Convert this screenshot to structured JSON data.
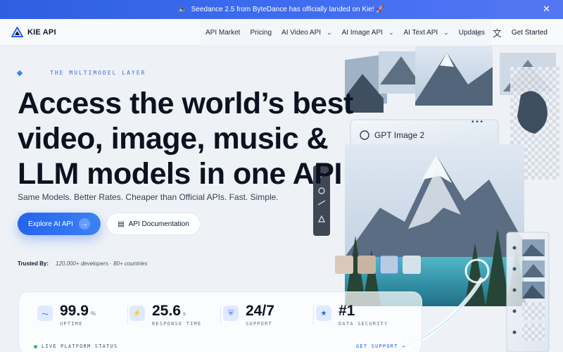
{
  "banner": {
    "text": "Seedance 2.5 from ByteDance has officially landed on Kie! 🚀",
    "speaker": "🔈",
    "close": "✕"
  },
  "nav": {
    "logo": "KIE API",
    "items": [
      {
        "label": "API Market",
        "chevron": false
      },
      {
        "label": "Pricing",
        "chevron": false
      },
      {
        "label": "AI Video API",
        "chevron": true
      },
      {
        "label": "AI Image API",
        "chevron": true
      },
      {
        "label": "AI Text API",
        "chevron": true
      },
      {
        "label": "Updates",
        "chevron": false
      }
    ],
    "theme_icon": "sun-icon",
    "language_icon": "translate-icon",
    "get_started": "Get Started"
  },
  "hero": {
    "eyebrow": "THE MULTIMODEL LAYER",
    "headline_lines": [
      "Access the world’s best",
      "video, image, music &",
      "LLM models in one API"
    ],
    "subhead": "Same Models. Better Rates. Cheaper than Official APIs. Fast. Simple.",
    "primary_button": "Explore AI API",
    "secondary_button": "API Documentation",
    "trusted_label": "Trusted By:",
    "trusted_value": "120,000+ developers · 80+ countries"
  },
  "art": {
    "card_label": "GPT Image 2",
    "menu_dots": "• • •"
  },
  "stats": [
    {
      "value": "99.9",
      "unit": "%",
      "label": "UPTIME",
      "icon": "pulse-icon"
    },
    {
      "value": "25.6",
      "unit": "s",
      "label": "RESPONSE TIME",
      "icon": "bolt-icon"
    },
    {
      "value": "24/7",
      "unit": "",
      "label": "SUPPORT",
      "icon": "shield-icon"
    },
    {
      "value": "#1",
      "unit": "",
      "label": "DATA SECURITY",
      "icon": "star-icon"
    }
  ],
  "footer": {
    "live": "LIVE PLATFORM STATUS",
    "support": "GET SUPPORT →"
  }
}
